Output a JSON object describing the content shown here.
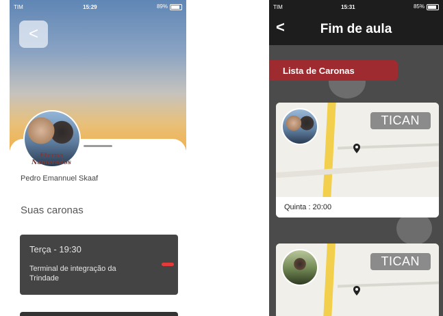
{
  "left_screen": {
    "status": {
      "carrier": "TIM",
      "time": "15:29",
      "battery": "89%"
    },
    "back_glyph": "<",
    "avatar_caption": "Eterno Namorados",
    "user_name": "Pedro Emannuel Skaaf",
    "section_title": "Suas caronas",
    "rides": [
      {
        "when": "Terça - 19:30",
        "place": "Terminal de integração da Trindade"
      }
    ],
    "colors": {
      "card": "#444444",
      "indicator": "#e53a3a"
    }
  },
  "right_screen": {
    "status": {
      "carrier": "TIM",
      "time": "15:31",
      "battery": "85%"
    },
    "back_glyph": "<",
    "title": "Fim de aula",
    "list_tab_label": "Lista de Caronas",
    "cards": [
      {
        "badge": "TICAN",
        "label": "Quinta : 20:00",
        "avatar": "couple-photo"
      },
      {
        "badge": "TICAN",
        "label": "",
        "avatar": "person-photo"
      }
    ],
    "colors": {
      "header": "#1d1d1d",
      "tab": "#9e2b2f",
      "badge": "#8b8b8b"
    }
  }
}
